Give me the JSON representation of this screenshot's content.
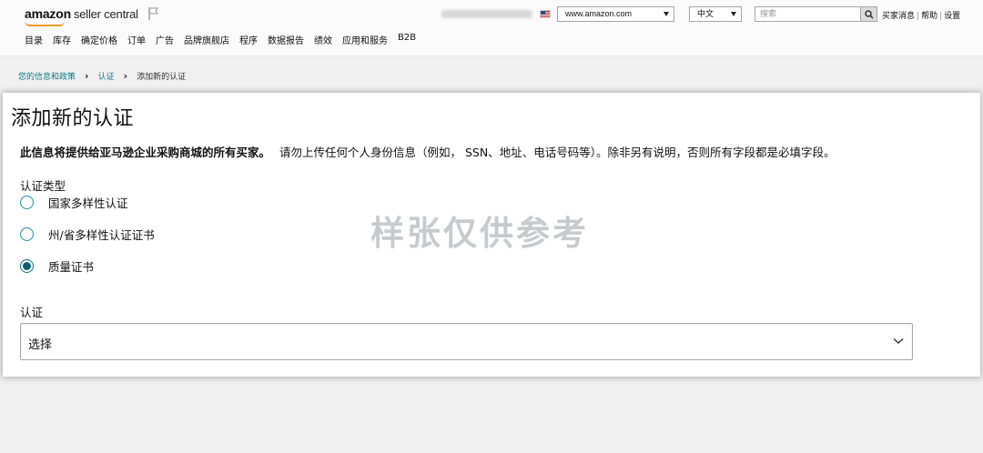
{
  "header": {
    "logo_brand": "amazon",
    "logo_product": "seller central",
    "marketplace": "www.amazon.com",
    "language": "中文",
    "search_placeholder": "搜索",
    "links": [
      "买家消息",
      "帮助",
      "设置"
    ]
  },
  "nav": {
    "items": [
      "目录",
      "库存",
      "确定价格",
      "订单",
      "广告",
      "品牌旗舰店",
      "程序",
      "数据报告",
      "绩效",
      "应用和服务",
      "B2B"
    ]
  },
  "breadcrumb": {
    "items": [
      "您的信息和政策",
      "认证"
    ],
    "current": "添加新的认证"
  },
  "form": {
    "title": "添加新的认证",
    "notice_bold": "此信息将提供给亚马逊企业采购商城的所有买家。",
    "notice_rest": "请勿上传任何个人身份信息（例如， SSN、地址、电话号码等）。除非另有说明，否则所有字段都是必填字段。",
    "cert_type_label": "认证类型",
    "options": [
      {
        "label": "国家多样性认证",
        "checked": false
      },
      {
        "label": "州/省多样性认证证书",
        "checked": false
      },
      {
        "label": "质量证书",
        "checked": true
      }
    ],
    "cert_label": "认证",
    "cert_value": "选择"
  },
  "watermark": "样张仅供参考",
  "colors": {
    "accent": "#0f7c89",
    "radio_border": "#1e8fa0",
    "logo_smile": "#f59a23"
  }
}
